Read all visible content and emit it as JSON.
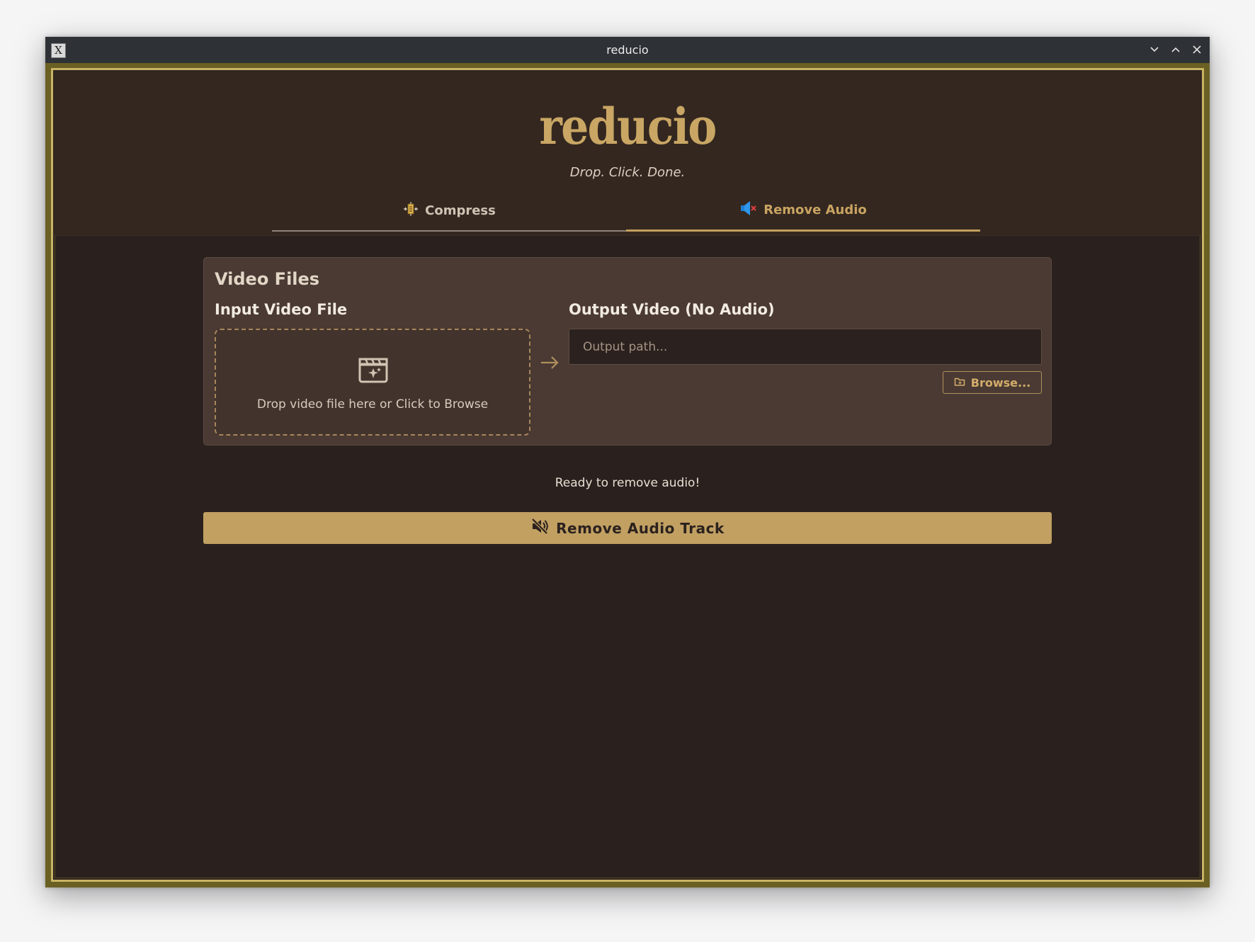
{
  "window": {
    "title": "reducio",
    "app_icon_glyph": "X",
    "controls": [
      "minimize-icon",
      "maximize-icon",
      "close-icon"
    ]
  },
  "header": {
    "logo": "reducio",
    "tagline": "Drop. Click. Done."
  },
  "tabs": [
    {
      "label": "Compress",
      "icon": "compress-icon",
      "active": false
    },
    {
      "label": "Remove Audio",
      "icon": "speaker-muted-icon",
      "active": true
    }
  ],
  "video_files": {
    "title": "Video Files",
    "input": {
      "label": "Input Video File",
      "drop_text": "Drop video file here or Click to Browse",
      "icon": "video-file-icon"
    },
    "arrow_icon": "arrow-right-icon",
    "output": {
      "label": "Output Video (No Audio)",
      "value": "",
      "placeholder": "Output path...",
      "browse_label": "Browse...",
      "browse_icon": "folder-icon"
    }
  },
  "status": "Ready to remove audio!",
  "action": {
    "label": "Remove Audio Track",
    "icon": "volume-off-icon"
  },
  "colors": {
    "accent": "#c1a062",
    "background": "#2a201e",
    "card": "#4a3a33",
    "frame_gold": "#c7b465"
  }
}
